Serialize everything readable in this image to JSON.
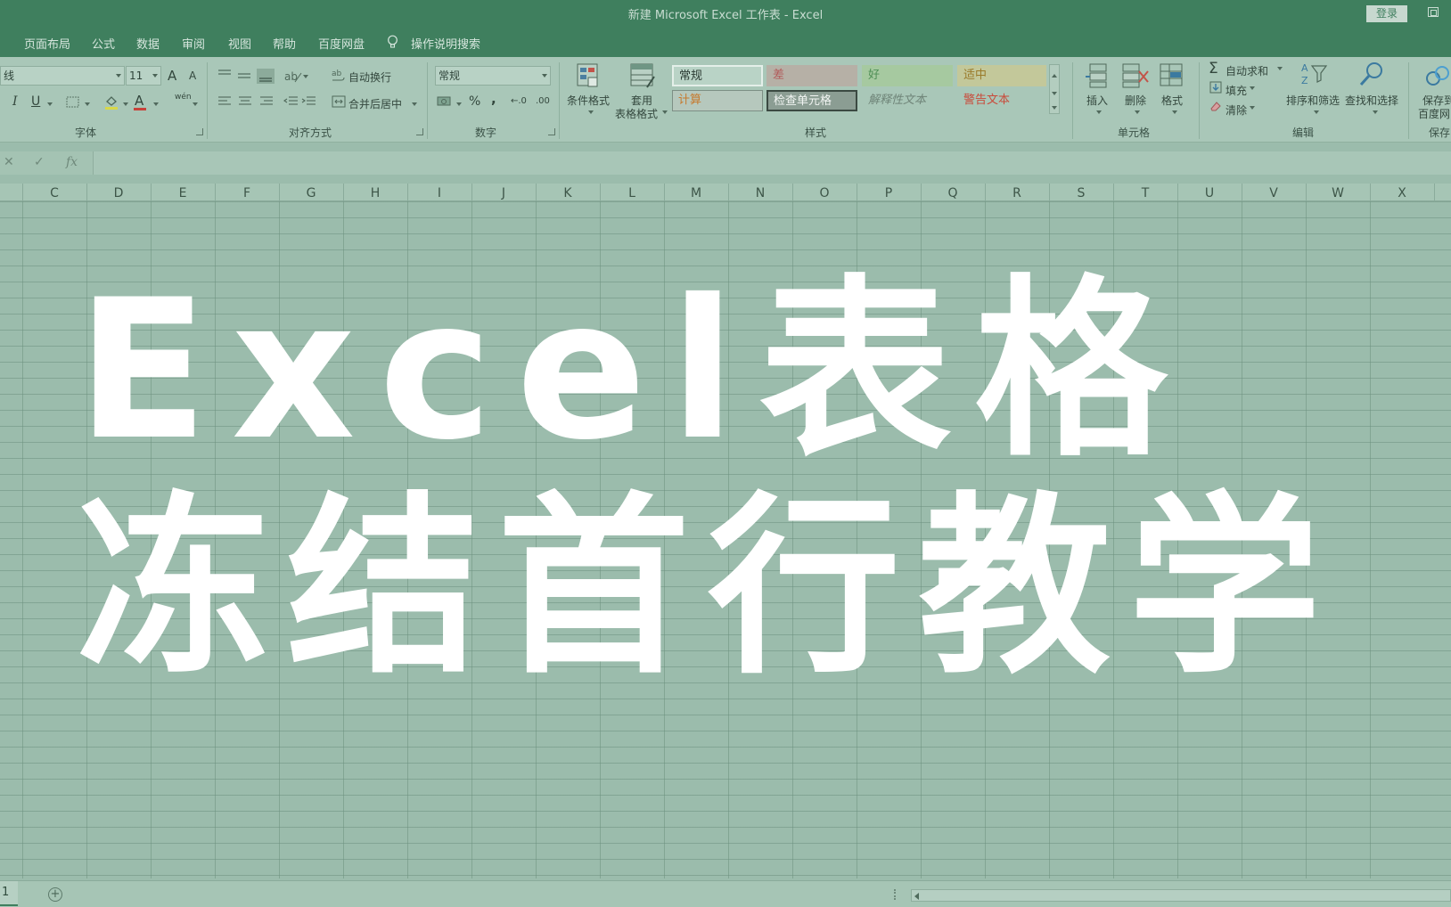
{
  "window": {
    "title": "新建 Microsoft Excel 工作表  -  Excel",
    "login_label": "登录"
  },
  "menu": {
    "tabs": [
      "页面布局",
      "公式",
      "数据",
      "审阅",
      "视图",
      "帮助",
      "百度网盘"
    ],
    "search_label": "操作说明搜索"
  },
  "ribbon": {
    "font": {
      "font_name": "线",
      "font_size": "11",
      "grow_label": "A",
      "shrink_label": "A",
      "italic": "I",
      "underline": "U",
      "font_color_label": "A",
      "phonetic_label": "wén",
      "group_label": "字体"
    },
    "alignment": {
      "wrap_text": "自动换行",
      "merge_center": "合并后居中",
      "group_label": "对齐方式"
    },
    "number": {
      "format": "常规",
      "percent": "%",
      "comma": ",",
      "inc_decimal": "←.0",
      "dec_decimal": ".00",
      "group_label": "数字"
    },
    "styles": {
      "conditional_format": "条件格式",
      "table_format_line1": "套用",
      "table_format_line2": "表格格式",
      "cells": [
        {
          "label": "常规",
          "color": "#34473d"
        },
        {
          "label": "差",
          "color": "#b25a5a"
        },
        {
          "label": "好",
          "color": "#4f8f56"
        },
        {
          "label": "适中",
          "color": "#9a7a2a"
        },
        {
          "label": "计算",
          "color": "#c67a2e"
        },
        {
          "label": "检查单元格",
          "color": "#f2f5f3"
        },
        {
          "label": "解释性文本",
          "color": "#6f8478"
        },
        {
          "label": "警告文本",
          "color": "#c94a3a"
        }
      ],
      "group_label": "样式"
    },
    "cells": {
      "insert": "插入",
      "delete": "删除",
      "format": "格式",
      "group_label": "单元格"
    },
    "editing": {
      "autosum": "自动求和",
      "fill": "填充",
      "clear": "清除",
      "sort_filter": "排序和筛选",
      "find_select": "查找和选择",
      "group_label": "编辑"
    },
    "save": {
      "line1": "保存到",
      "line2": "百度网",
      "group_label": "保存"
    }
  },
  "formula_bar": {
    "cancel": "✕",
    "confirm": "✓",
    "fx": "fx",
    "value": ""
  },
  "columns": [
    "C",
    "D",
    "E",
    "F",
    "G",
    "H",
    "I",
    "J",
    "K",
    "L",
    "M",
    "N",
    "O",
    "P",
    "Q",
    "R",
    "S",
    "T",
    "U",
    "V",
    "W",
    "X"
  ],
  "overlay": {
    "line1": "Excel表格",
    "line2": "冻结首行教学"
  },
  "sheet_bar": {
    "active_tab": "1",
    "add_sheet": "+"
  },
  "colors": {
    "accent": "#3f7f5e",
    "grid_bg": "#9bbcac",
    "overlay_text": "#ffffff"
  }
}
